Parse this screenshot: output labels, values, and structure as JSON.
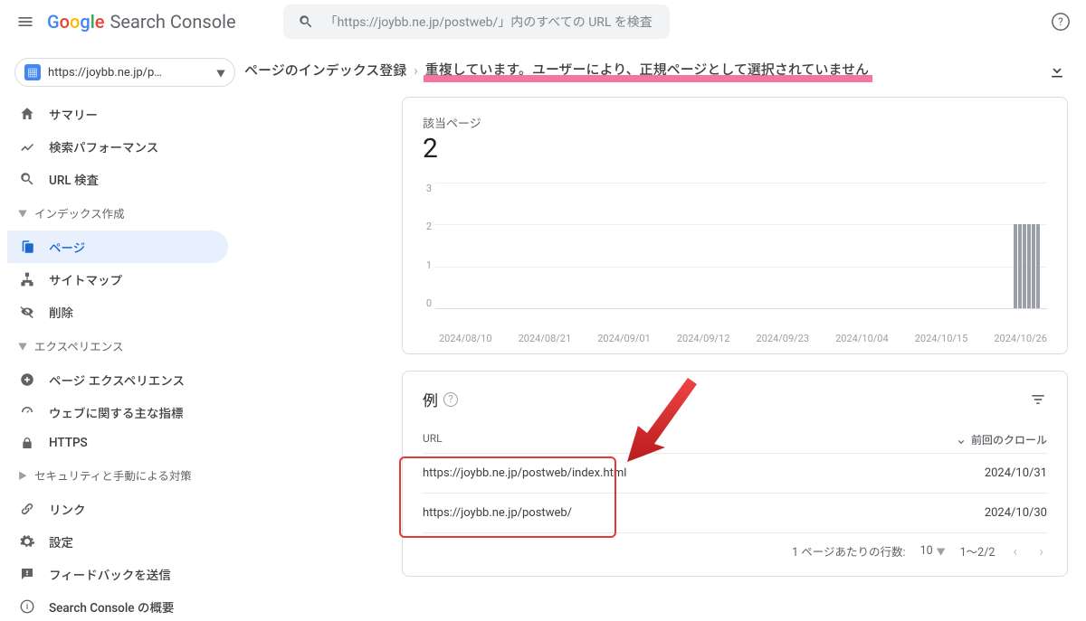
{
  "header": {
    "logo_text": "Search Console",
    "search_placeholder": "「https://joybb.ne.jp/postweb/」内のすべての URL を検査"
  },
  "property": {
    "label": "https://joybb.ne.jp/p…"
  },
  "sidebar": {
    "items": {
      "summary": "サマリー",
      "performance": "検索パフォーマンス",
      "url_inspect": "URL 検査"
    },
    "group_index": "インデックス作成",
    "index": {
      "pages": "ページ",
      "sitemaps": "サイトマップ",
      "removals": "削除"
    },
    "group_experience": "エクスペリエンス",
    "experience": {
      "page_exp": "ページ エクスペリエンス",
      "cwv": "ウェブに関する主な指標",
      "https": "HTTPS"
    },
    "group_security": "セキュリティと手動による対策",
    "links": "リンク",
    "settings": "設定",
    "feedback": "フィードバックを送信",
    "about": "Search Console の概要"
  },
  "breadcrumb": {
    "a": "ページのインデックス登録",
    "b": "重複しています。ユーザーにより、正規ページとして選択されていません"
  },
  "chart_data": {
    "type": "bar",
    "title": "該当ページ",
    "value": "2",
    "ylim": [
      0,
      3
    ],
    "yticks": [
      "3",
      "2",
      "1",
      "0"
    ],
    "categories": [
      "2024/08/10",
      "2024/08/21",
      "2024/09/01",
      "2024/09/12",
      "2024/09/23",
      "2024/10/04",
      "2024/10/15",
      "2024/10/26"
    ],
    "last_bars": [
      2,
      2,
      2,
      2,
      2,
      2
    ]
  },
  "examples": {
    "title": "例",
    "col_url": "URL",
    "col_crawl": "前回のクロール",
    "rows": [
      {
        "url": "https://joybb.ne.jp/postweb/index.html",
        "date": "2024/10/31"
      },
      {
        "url": "https://joybb.ne.jp/postweb/",
        "date": "2024/10/30"
      }
    ],
    "pager": {
      "rows_per_page_label": "1 ページあたりの行数:",
      "rows_per_page_value": "10",
      "range": "1～2/2"
    }
  }
}
